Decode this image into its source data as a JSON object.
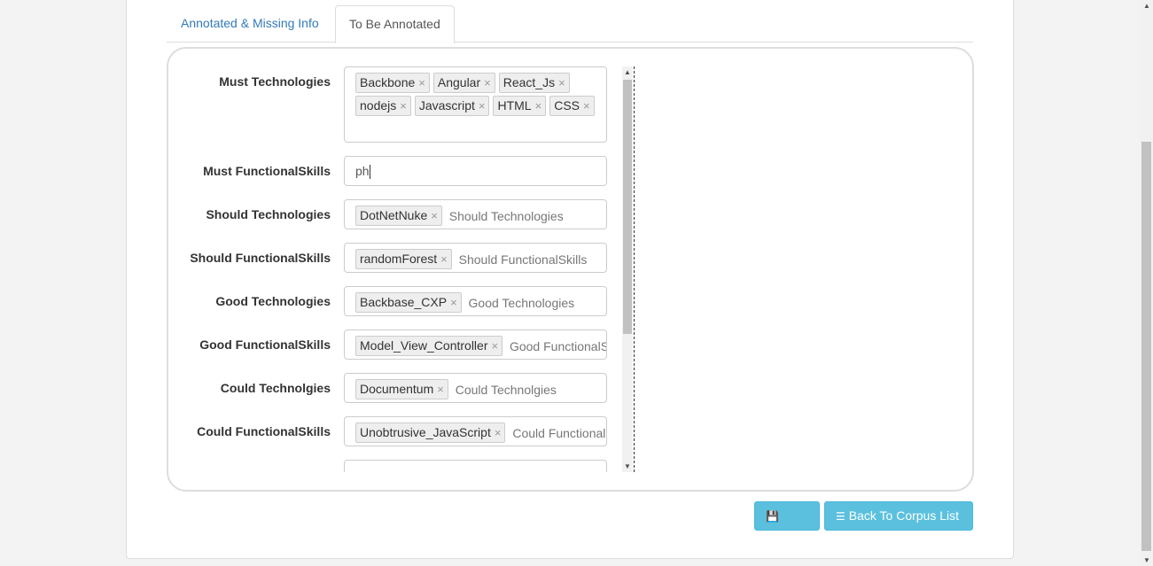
{
  "tabs": {
    "annotated": "Annotated & Missing Info",
    "to_be_annotated": "To Be Annotated"
  },
  "fields": {
    "must_technologies": {
      "label": "Must Technologies",
      "tags": [
        "Backbone",
        "Angular",
        "React_Js",
        "nodejs",
        "Javascript",
        "HTML",
        "CSS"
      ]
    },
    "must_functional_skills": {
      "label": "Must FunctionalSkills",
      "value": "ph"
    },
    "should_technologies": {
      "label": "Should Technologies",
      "tags": [
        "DotNetNuke"
      ],
      "placeholder": "Should Technologies"
    },
    "should_functional_skills": {
      "label": "Should FunctionalSkills",
      "tags": [
        "randomForest"
      ],
      "placeholder": "Should FunctionalSkills"
    },
    "good_technologies": {
      "label": "Good Technologies",
      "tags": [
        "Backbase_CXP"
      ],
      "placeholder": "Good Technologies"
    },
    "good_functional_skills": {
      "label": "Good FunctionalSkills",
      "tags": [
        "Model_View_Controller"
      ],
      "placeholder": "Good FunctionalSkills"
    },
    "could_technologies": {
      "label": "Could Technolgies",
      "tags": [
        "Documentum"
      ],
      "placeholder": "Could Technolgies"
    },
    "could_functional_skills": {
      "label": "Could FunctionalSkills",
      "tags": [
        "Unobtrusive_JavaScript"
      ],
      "placeholder": "Could FunctionalSkills"
    }
  },
  "buttons": {
    "save": "Save",
    "save_icon": "floppy-disk-icon",
    "back": "Back To Corpus List",
    "back_icon": "list-icon"
  },
  "tag_remove_glyph": "×",
  "colors": {
    "link": "#337ab7",
    "button_info": "#5bc0de",
    "tag_bg": "#eeeeee"
  }
}
